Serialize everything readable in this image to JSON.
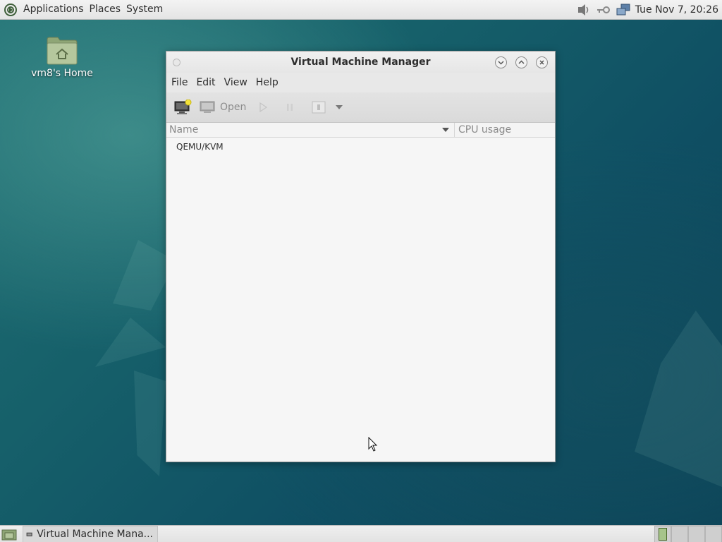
{
  "top_panel": {
    "menu": [
      "Applications",
      "Places",
      "System"
    ],
    "clock": "Tue Nov 7, 20:26",
    "tray_icons": [
      "volume-icon",
      "network-key-icon",
      "network-icon"
    ]
  },
  "desktop": {
    "home_icon_label": "vm8's Home"
  },
  "window": {
    "title": "Virtual Machine Manager",
    "menu": [
      "File",
      "Edit",
      "View",
      "Help"
    ],
    "toolbar": {
      "new_vm_icon": "new-vm-icon",
      "open_label": "Open",
      "run_icon": "play-icon",
      "pause_icon": "pause-icon",
      "shutdown_icon": "shutdown-icon"
    },
    "columns": {
      "name": "Name",
      "cpu": "CPU usage"
    },
    "connections": [
      "QEMU/KVM"
    ]
  },
  "taskbar": {
    "task_label": "Virtual Machine Mana..."
  }
}
